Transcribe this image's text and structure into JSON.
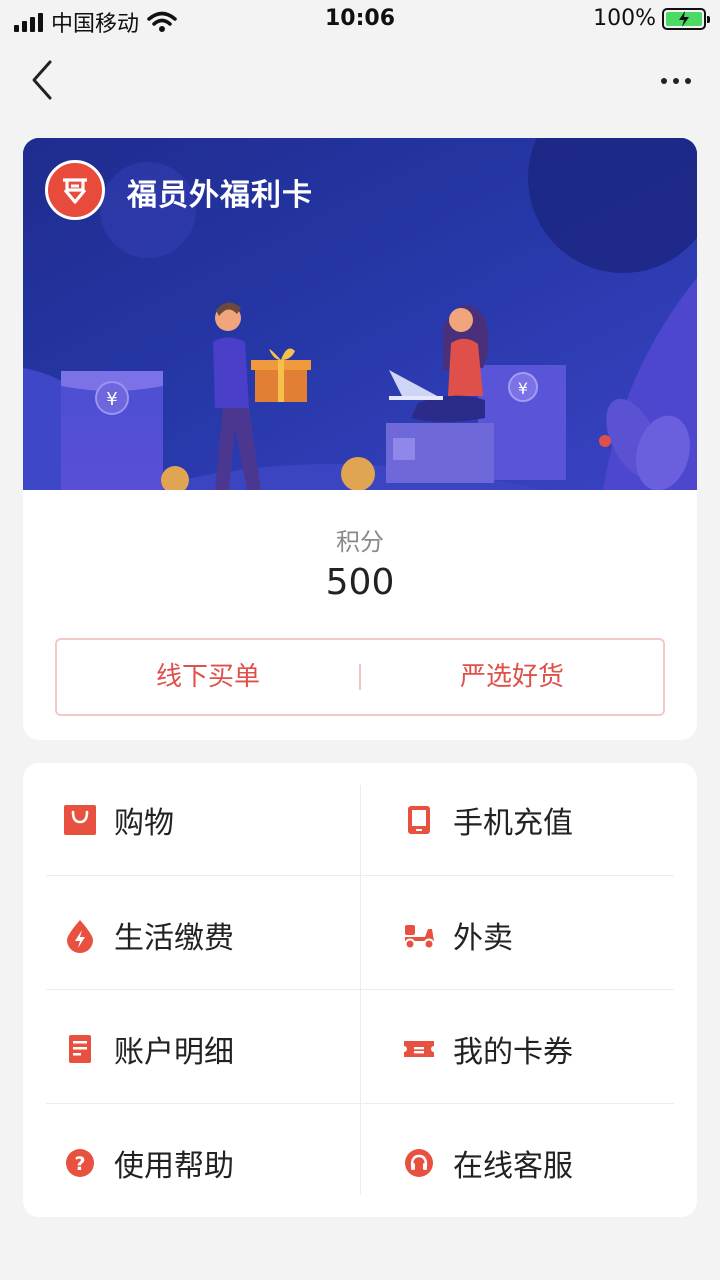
{
  "status_bar": {
    "carrier": "中国移动",
    "time": "10:06",
    "battery": "100%"
  },
  "card": {
    "title": "福员外福利卡",
    "points_label": "积分",
    "points_value": "500",
    "actions": [
      {
        "label": "线下买单"
      },
      {
        "label": "严选好货"
      }
    ]
  },
  "menu": {
    "items": [
      {
        "label": "购物",
        "icon": "shopping-bag-icon"
      },
      {
        "label": "手机充值",
        "icon": "phone-icon"
      },
      {
        "label": "生活缴费",
        "icon": "utility-drop-icon"
      },
      {
        "label": "外卖",
        "icon": "scooter-icon"
      },
      {
        "label": "账户明细",
        "icon": "document-icon"
      },
      {
        "label": "我的卡券",
        "icon": "ticket-icon"
      },
      {
        "label": "使用帮助",
        "icon": "question-icon"
      },
      {
        "label": "在线客服",
        "icon": "headset-icon"
      }
    ]
  },
  "colors": {
    "accent": "#e0504a",
    "banner": "#2a2f9b"
  }
}
